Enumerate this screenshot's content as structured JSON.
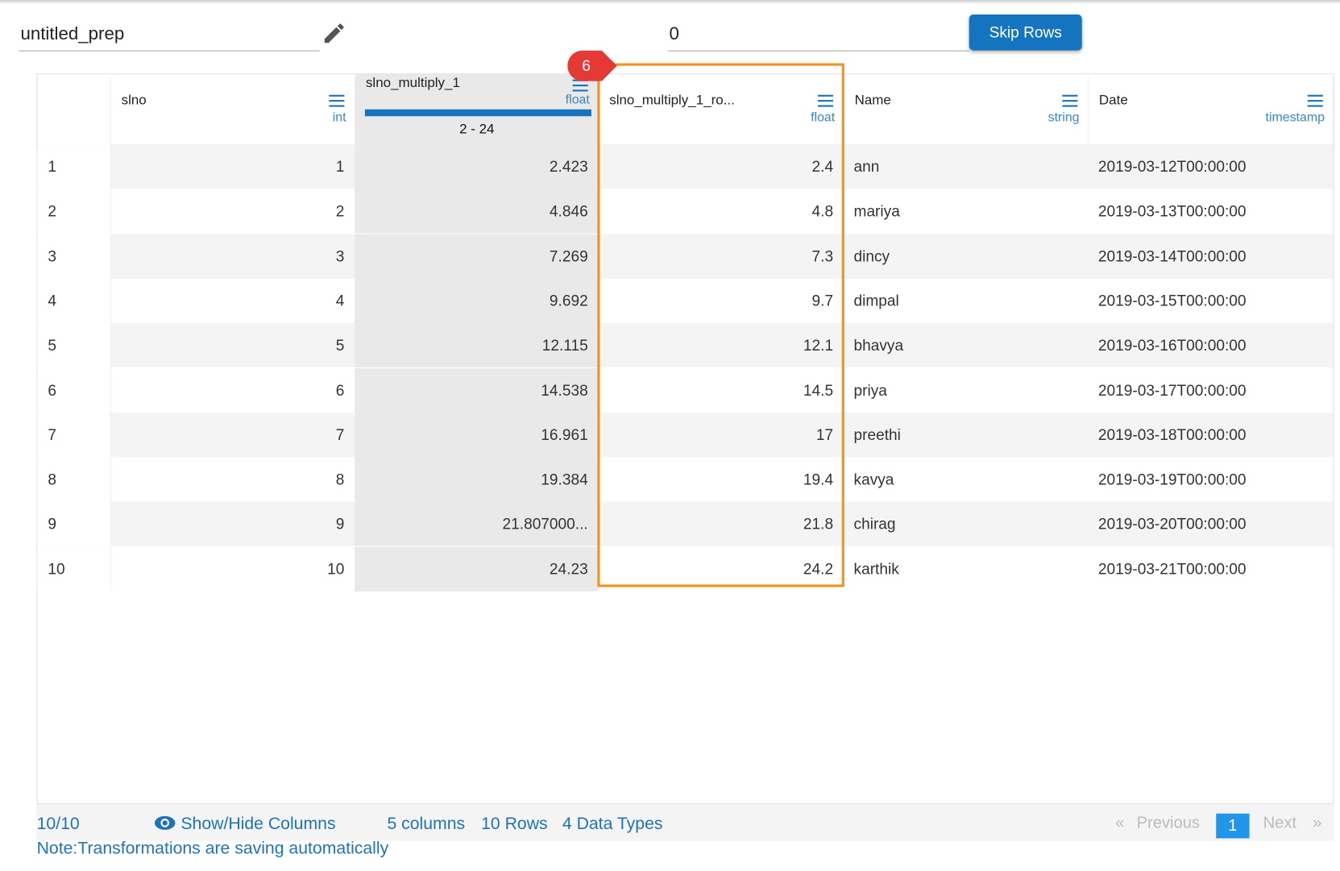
{
  "prep_name": "untitled_prep",
  "skip_rows_value": "0",
  "skip_rows_button": "Skip Rows",
  "step_badge": "6",
  "columns": [
    {
      "name": "slno",
      "type": "int"
    },
    {
      "name": "slno_multiply_1",
      "type": "float",
      "range": "2 - 24"
    },
    {
      "name": "slno_multiply_1_ro...",
      "type": "float"
    },
    {
      "name": "Name",
      "type": "string"
    },
    {
      "name": "Date",
      "type": "timestamp"
    }
  ],
  "rows": [
    [
      "1",
      "1",
      "2.423",
      "2.4",
      "ann",
      "2019-03-12T00:00:00"
    ],
    [
      "2",
      "2",
      "4.846",
      "4.8",
      "mariya",
      "2019-03-13T00:00:00"
    ],
    [
      "3",
      "3",
      "7.269",
      "7.3",
      "dincy",
      "2019-03-14T00:00:00"
    ],
    [
      "4",
      "4",
      "9.692",
      "9.7",
      "dimpal",
      "2019-03-15T00:00:00"
    ],
    [
      "5",
      "5",
      "12.115",
      "12.1",
      "bhavya",
      "2019-03-16T00:00:00"
    ],
    [
      "6",
      "6",
      "14.538",
      "14.5",
      "priya",
      "2019-03-17T00:00:00"
    ],
    [
      "7",
      "7",
      "16.961",
      "17",
      "preethi",
      "2019-03-18T00:00:00"
    ],
    [
      "8",
      "8",
      "19.384",
      "19.4",
      "kavya",
      "2019-03-19T00:00:00"
    ],
    [
      "9",
      "9",
      "21.807000...",
      "21.8",
      "chirag",
      "2019-03-20T00:00:00"
    ],
    [
      "10",
      "10",
      "24.23",
      "24.2",
      "karthik",
      "2019-03-21T00:00:00"
    ]
  ],
  "footer": {
    "count": "10/10",
    "show_hide": "Show/Hide Columns",
    "columns": "5 columns",
    "rows": "10 Rows",
    "types": "4 Data Types",
    "prev_arrow": "«",
    "previous": "Previous",
    "page": "1",
    "next": "Next",
    "next_arrow": "»"
  },
  "note": "Note:Transformations are saving automatically"
}
